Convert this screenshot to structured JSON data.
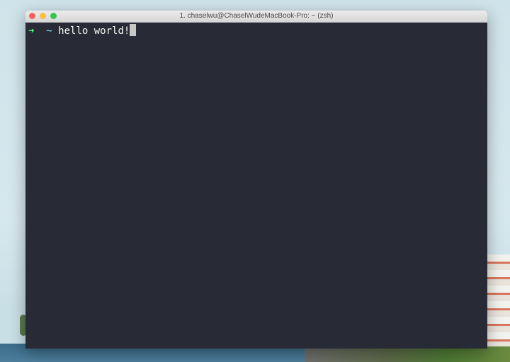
{
  "window": {
    "title": "1. chaselwu@ChaselWudeMacBook-Pro: ~ (zsh)"
  },
  "terminal": {
    "prompt_arrow": "➜",
    "cwd": "~",
    "command": "hello world!"
  },
  "colors": {
    "background": "#282a36",
    "arrow": "#50fa7b",
    "cwd": "#8be9fd",
    "text": "#f8f8f2"
  }
}
